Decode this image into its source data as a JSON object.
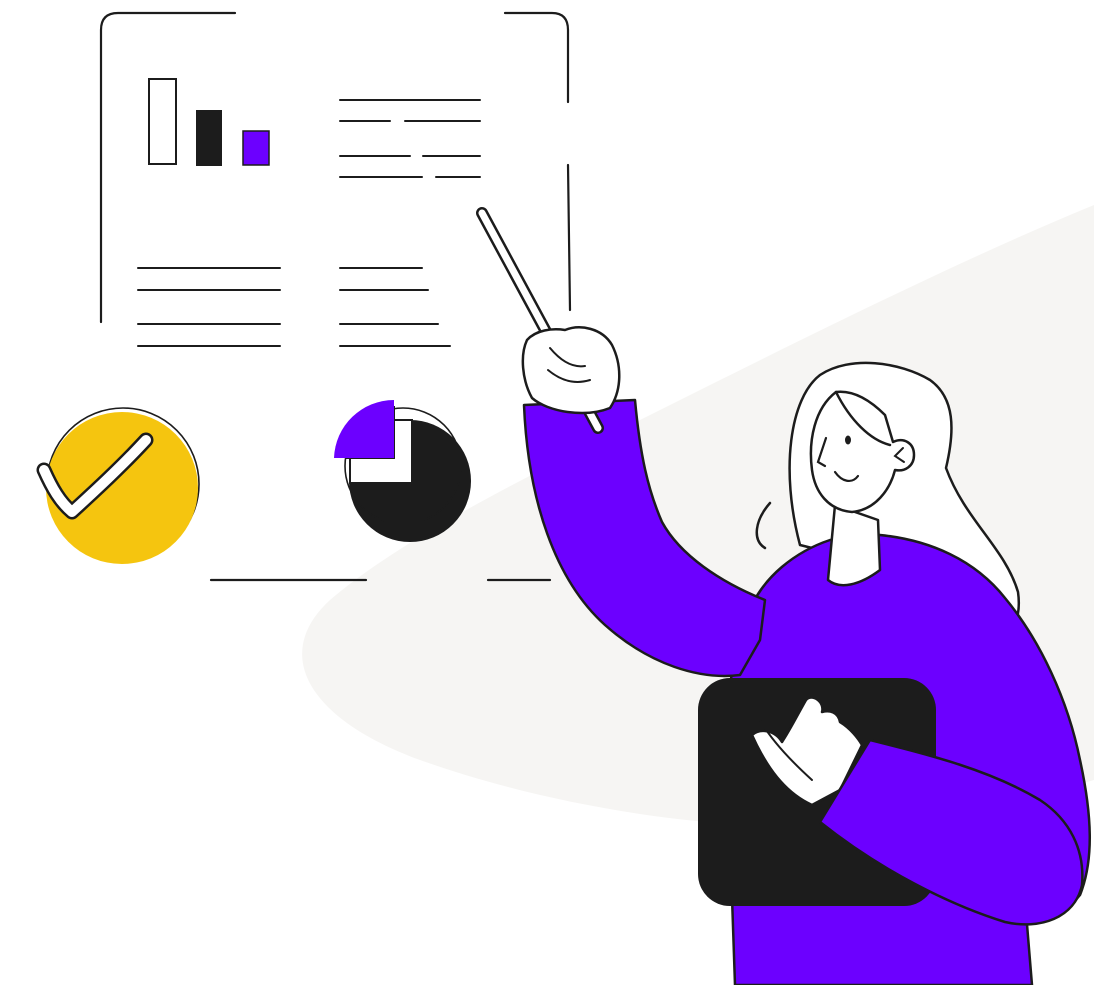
{
  "illustration": {
    "subject": "presenter-pointing-at-report",
    "colors": {
      "background": "#ffffff",
      "blob": "#f6f5f3",
      "ink": "#1c1c1c",
      "accent_purple": "#6c00ff",
      "accent_yellow": "#f5c50f",
      "skin": "#ffffff"
    },
    "icons": {
      "check": "check-badge-icon",
      "pie": "pie-chart-icon",
      "bars": "bar-chart-icon"
    }
  }
}
